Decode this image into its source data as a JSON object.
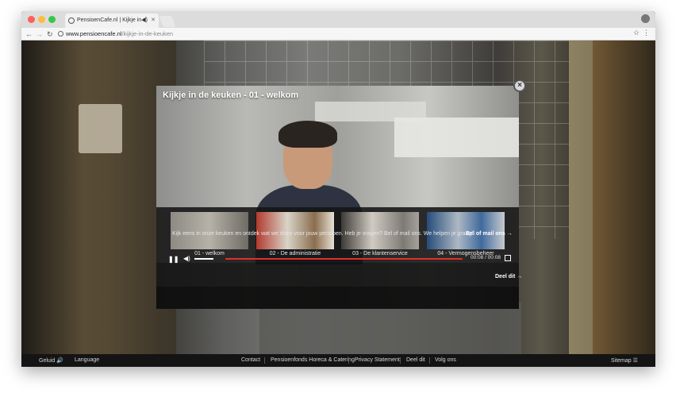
{
  "browser": {
    "tab_title": "PensioenCafe.nl | Kijkje in d",
    "url_domain": "www.pensioencafe.nl",
    "url_path": "/kijkje-in-de-keuken"
  },
  "video": {
    "title": "Kijkje in de keuken - 01 - welkom",
    "close_icon": "×",
    "thumbnails": [
      {
        "label": "01 - welkom"
      },
      {
        "label": "02 - De administratie"
      },
      {
        "label": "03 - De klantenservice"
      },
      {
        "label": "04 - Vermogensbeheer"
      }
    ],
    "info_text": "Kijk eens in onze keuken en ontdek wat we doen voor jouw pensioen. Heb je vragen? Bel of mail ons. We helpen je graag!",
    "call_link": "Bel of mail ons →",
    "time": "00:08 / 00:08",
    "progress": 1.0,
    "volume": 1.0,
    "share_link": "Deel dit →",
    "progress_color": "#e0302b"
  },
  "footer": {
    "geluid": "Geluid 🔊",
    "language": "Language",
    "contact": "Contact",
    "pensioenfonds": "Pensioenfonds Horeca & Catering",
    "privacy": "Privacy Statement",
    "deel": "Deel dit",
    "volg": "Volg ons",
    "sitemap": "Sitemap ☰"
  }
}
